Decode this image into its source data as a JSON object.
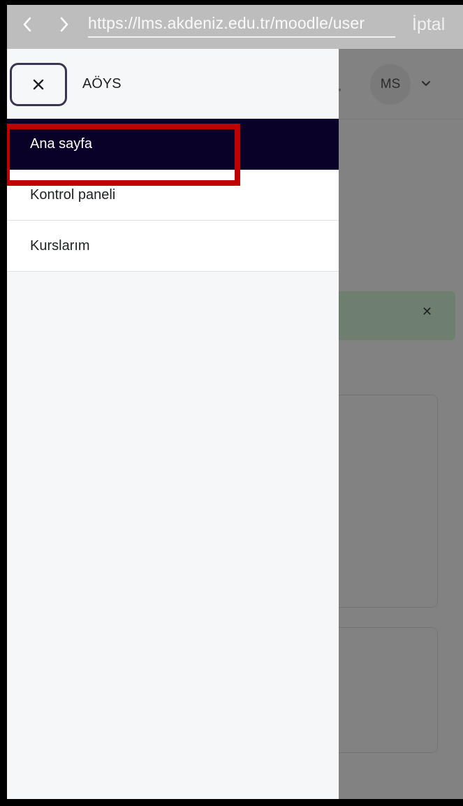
{
  "browser": {
    "url": "https://lms.akdeniz.edu.tr/moodle/user",
    "cancel_label": "İptal",
    "back_icon": "chevron-left-icon",
    "forward_icon": "chevron-right-icon"
  },
  "drawer": {
    "site_name": "AÖYS",
    "close_icon": "close-icon",
    "items": [
      {
        "label": "Ana sayfa",
        "active": true
      },
      {
        "label": "Kontrol paneli",
        "active": false,
        "highlighted": true
      },
      {
        "label": "Kurslarım",
        "active": false
      }
    ]
  },
  "header": {
    "user_initials": "MS",
    "menu_icon": "chevron-down-icon"
  },
  "colors": {
    "drawer_active": "#0a0128",
    "highlight": "#c00000",
    "overlay": "#828282"
  }
}
